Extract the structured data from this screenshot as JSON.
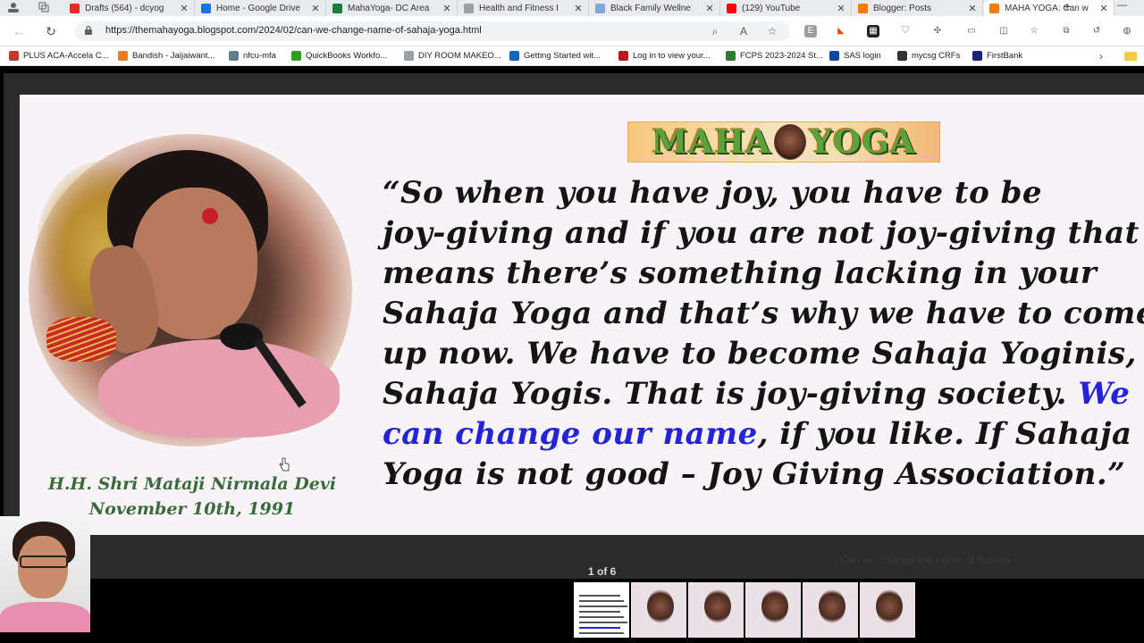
{
  "browser": {
    "tabs": [
      {
        "title": "Drafts (564) - dcyog",
        "icon": "gmail-icon",
        "color": "#d93025"
      },
      {
        "title": "Home - Google Drive",
        "icon": "drive-icon",
        "color": "#1a73e8"
      },
      {
        "title": "MahaYoga- DC Area",
        "icon": "sheets-icon",
        "color": "#188038"
      },
      {
        "title": "Health and Fitness I",
        "icon": "page-icon",
        "color": "#9aa0a6"
      },
      {
        "title": "Black Family Wellne",
        "icon": "cloud-icon",
        "color": "#7fa7d9"
      },
      {
        "title": "(129) YouTube",
        "icon": "youtube-icon",
        "color": "#ff0000"
      },
      {
        "title": "Blogger: Posts",
        "icon": "blogger-icon",
        "color": "#f57c00"
      },
      {
        "title": "MAHA YOGA: Can w",
        "icon": "blogger-icon",
        "color": "#f57c00",
        "active": true
      }
    ],
    "new_tab": "+",
    "minimize": "—",
    "url": "https://themahayoga.blogspot.com/2024/02/can-we-change-name-of-sahaja-yoga.html",
    "bookmarks": [
      {
        "label": "PLUS ACA-Accela C...",
        "icon": "accela-icon",
        "color": "#c0392b"
      },
      {
        "label": "Bandish - Jaijaiwant...",
        "icon": "bandish-icon",
        "color": "#e67e22"
      },
      {
        "label": "nfcu-mfa",
        "icon": "cloud-icon",
        "color": "#607d8b"
      },
      {
        "label": "QuickBooks Workfo...",
        "icon": "quickbooks-icon",
        "color": "#2ca01c"
      },
      {
        "label": "DIY ROOM MAKEO...",
        "icon": "page-icon",
        "color": "#9aa0a6"
      },
      {
        "label": "Getting Started wit...",
        "icon": "play-icon",
        "color": "#1565c0"
      },
      {
        "label": "Log in to view your...",
        "icon": "v-icon",
        "color": "#b71c1c"
      },
      {
        "label": "FCPS 2023-2024 St...",
        "icon": "fcps-icon",
        "color": "#2e7d32"
      },
      {
        "label": "SAS login",
        "icon": "sas-icon",
        "color": "#0d47a1"
      },
      {
        "label": "mycsg CRFs",
        "icon": "m-icon",
        "color": "#333333"
      },
      {
        "label": "FirstBank",
        "icon": "firstbank-icon",
        "color": "#1a237e"
      }
    ]
  },
  "slide": {
    "logo_left": "MAHA",
    "logo_right": "YOGA",
    "quote_lines": [
      "“So when you have joy, you have to be",
      "joy-giving and if you are not joy-giving that",
      "means there’s something lacking in your",
      "Sahaja Yoga and that’s why we have to come",
      "up now. We have to become Sahaja Yoginis,",
      "Sahaja Yogis. That is joy-giving society. "
    ],
    "quote_highlight_1": "We",
    "quote_highlight_2": "can change our name",
    "quote_after_highlight": ", if you like. If Sahaja",
    "quote_last_line": "Yoga is not good – Joy Giving Association.”",
    "caption_name": "H.H. Shri Mataji Nirmala Devi",
    "caption_date": "November 10th, 1991"
  },
  "viewer": {
    "page_counter": "1 of 6",
    "thumbnail_count": 6,
    "background_text": "Can we change the name of Sahaja"
  },
  "colors": {
    "quote_highlight": "#2424d6",
    "caption": "#3b6b3c",
    "logo_green": "#5aa23a"
  }
}
